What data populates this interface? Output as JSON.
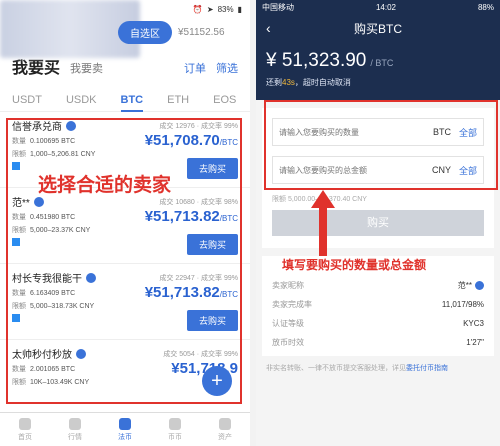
{
  "left": {
    "status": {
      "battery": "83%"
    },
    "top": {
      "pill": "自选区",
      "price": "¥51152.56"
    },
    "header": {
      "title": "我要买",
      "sub": "我要卖",
      "orders": "订单",
      "filter": "筛选"
    },
    "coins": [
      "USDT",
      "USDK",
      "BTC",
      "ETH",
      "EOS"
    ],
    "annotation": "选择合适的卖家",
    "sellers": [
      {
        "name": "信誉承兑商",
        "stats": "成交 12976 · 成交率 99%",
        "price": "¥51,708.70",
        "unit": "/BTC",
        "qty_label": "数量",
        "qty": "0.100695 BTC",
        "lim_label": "限额",
        "limit": "1,000–5,206.81 CNY",
        "btn": "去购买"
      },
      {
        "name": "范**",
        "stats": "成交 10680 · 成交率 98%",
        "price": "¥51,713.82",
        "unit": "/BTC",
        "qty_label": "数量",
        "qty": "0.451980 BTC",
        "lim_label": "限额",
        "limit": "5,000–23.37K CNY",
        "btn": "去购买"
      },
      {
        "name": "村长专我很能干",
        "stats": "成交 22947 · 成交率 99%",
        "price": "¥51,713.82",
        "unit": "/BTC",
        "qty_label": "数量",
        "qty": "6.163409 BTC",
        "lim_label": "限额",
        "limit": "5,000–318.73K CNY",
        "btn": "去购买"
      },
      {
        "name": "太帅秒付秒放",
        "stats": "成交 5054 · 成交率 99%",
        "price": "¥51,718.9",
        "unit": "",
        "qty_label": "数量",
        "qty": "2.001065 BTC",
        "lim_label": "限额",
        "limit": "10K–103.49K CNY",
        "btn": ""
      }
    ],
    "tabs": [
      "首页",
      "行情",
      "法币",
      "币币",
      "资产"
    ]
  },
  "right": {
    "status": {
      "carrier": "中国移动",
      "time": "14:02",
      "battery": "88%"
    },
    "title": "购买BTC",
    "price": "¥ 51,323.90",
    "price_unit": "/ BTC",
    "timer_prefix": "还剩",
    "timer_val": "43s",
    "timer_suffix": "，超时自动取消",
    "qty_placeholder": "请输入您要购买的数量",
    "qty_unit": "BTC",
    "amt_placeholder": "请输入您要购买的总金额",
    "amt_unit": "CNY",
    "all_label": "全部",
    "limit": "限额 5,000.00–23,370.40 CNY",
    "buy_btn": "购买",
    "annotation": "填写要购买的数量或总金额",
    "info": [
      {
        "k": "卖家昵称",
        "v": "范**"
      },
      {
        "k": "卖家完成率",
        "v": "11,017/98%"
      },
      {
        "k": "认证等级",
        "v": "KYC3"
      },
      {
        "k": "放币时效",
        "v": "1'27\""
      }
    ],
    "notice": "非实名转账、一律不放币提交客服处理，详见",
    "notice_link": "委托付币指南"
  }
}
